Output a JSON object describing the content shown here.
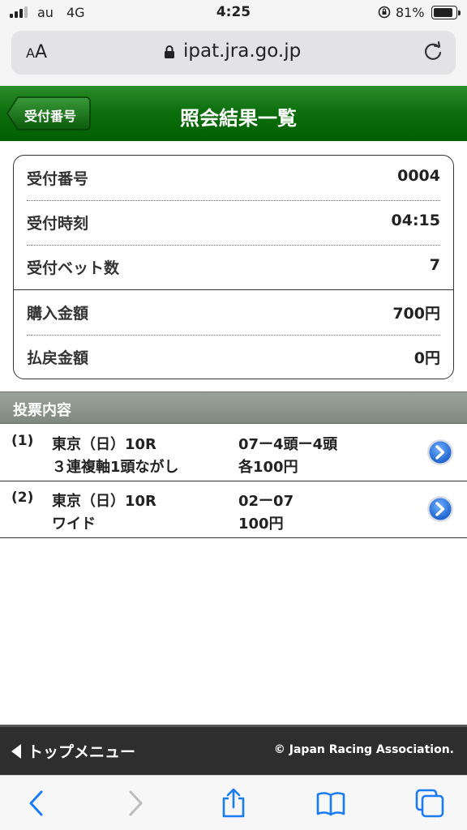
{
  "status_bar": {
    "carrier": "au",
    "network": "4G",
    "time": "4:25",
    "battery_percent": "81%",
    "battery_level": 0.81
  },
  "browser": {
    "text_size_label_small": "A",
    "text_size_label_large": "A",
    "url": "ipat.jra.go.jp"
  },
  "header": {
    "back_label": "受付番号",
    "title": "照会結果一覧"
  },
  "summary": [
    {
      "label": "受付番号",
      "value": "0004"
    },
    {
      "label": "受付時刻",
      "value": "04:15"
    },
    {
      "label": "受付ベット数",
      "value": "7"
    },
    {
      "label": "購入金額",
      "value": "700円"
    },
    {
      "label": "払戻金額",
      "value": "0円"
    }
  ],
  "section_title": "投票内容",
  "bets": [
    {
      "num": "(1)",
      "race": "東京（日）10R",
      "type": "３連複軸1頭ながし",
      "combo": "07ー4頭ー4頭",
      "amount": "各100円"
    },
    {
      "num": "(2)",
      "race": "東京（日）10R",
      "type": "ワイド",
      "combo": "02ー07",
      "amount": "100円"
    }
  ],
  "footer": {
    "menu_label": "トップメニュー",
    "copyright": "© Japan Racing Association."
  },
  "colors": {
    "header_green": "#0e6f0e",
    "section_gray": "#8c958c",
    "ios_blue": "#1a7cf5"
  },
  "icons": [
    "signal-icon",
    "orientation-lock-icon",
    "battery-icon",
    "lock-icon",
    "reload-icon",
    "back-arrow-icon",
    "chevron-right-icon",
    "share-icon",
    "bookmarks-icon",
    "tabs-icon"
  ]
}
